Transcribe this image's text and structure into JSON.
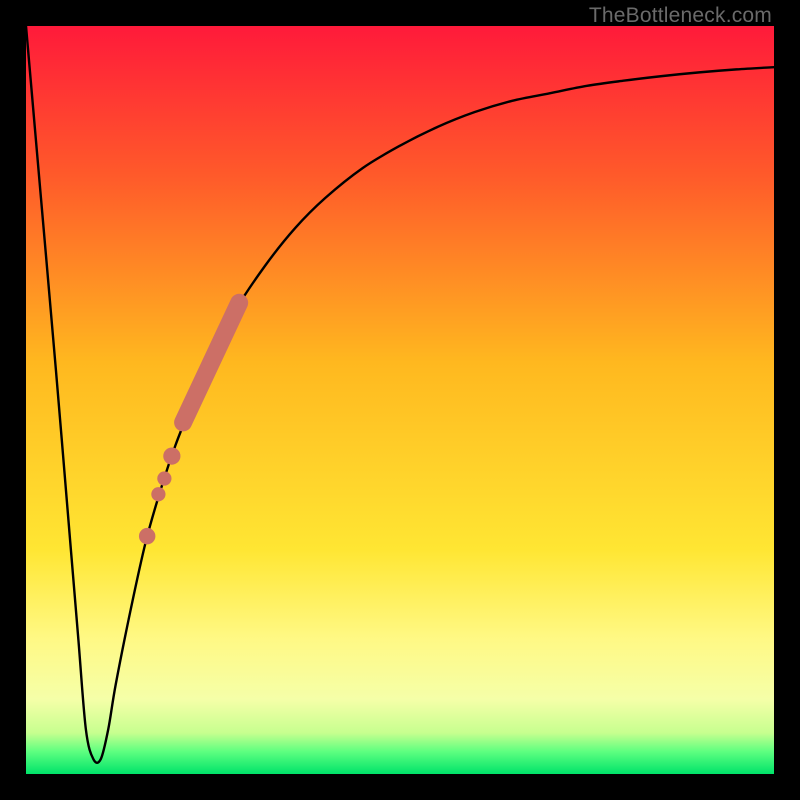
{
  "attribution": "TheBottleneck.com",
  "colors": {
    "frame": "#000000",
    "curve": "#000000",
    "marker_fill": "#cc6f66",
    "gradient_stops": [
      {
        "offset": 0.0,
        "color": "#ff1a3a"
      },
      {
        "offset": 0.2,
        "color": "#ff5a2a"
      },
      {
        "offset": 0.45,
        "color": "#ffb81f"
      },
      {
        "offset": 0.7,
        "color": "#ffe633"
      },
      {
        "offset": 0.82,
        "color": "#fff985"
      },
      {
        "offset": 0.9,
        "color": "#f5ffa8"
      },
      {
        "offset": 0.945,
        "color": "#c7ff8f"
      },
      {
        "offset": 0.97,
        "color": "#5eff80"
      },
      {
        "offset": 1.0,
        "color": "#00e36a"
      }
    ]
  },
  "chart_data": {
    "type": "line",
    "title": "",
    "xlabel": "",
    "ylabel": "",
    "xlim": [
      0,
      100
    ],
    "ylim": [
      0,
      100
    ],
    "series": [
      {
        "name": "bottleneck-curve",
        "x": [
          0,
          2,
          4,
          6,
          7,
          8,
          9,
          10,
          11,
          12,
          14,
          16,
          18,
          20,
          22,
          25,
          28,
          32,
          36,
          40,
          45,
          50,
          55,
          60,
          65,
          70,
          75,
          80,
          85,
          90,
          95,
          100
        ],
        "y": [
          100,
          77,
          54,
          30,
          18,
          6,
          2,
          2,
          6,
          12,
          22,
          31,
          38,
          44,
          49,
          56,
          62,
          68,
          73,
          77,
          81,
          84,
          86.5,
          88.5,
          90,
          91,
          92,
          92.7,
          93.3,
          93.8,
          94.2,
          94.5
        ]
      }
    ],
    "markers": [
      {
        "type": "thick-segment",
        "x1": 21,
        "y1": 47,
        "x2": 28.5,
        "y2": 63,
        "radius": 1.2
      },
      {
        "type": "dot",
        "x": 19.5,
        "y": 42.5,
        "radius": 1.15
      },
      {
        "type": "dot",
        "x": 18.5,
        "y": 39.5,
        "radius": 0.95
      },
      {
        "type": "dot",
        "x": 17.7,
        "y": 37.4,
        "radius": 0.95
      },
      {
        "type": "dot",
        "x": 16.2,
        "y": 31.8,
        "radius": 1.1
      }
    ]
  }
}
